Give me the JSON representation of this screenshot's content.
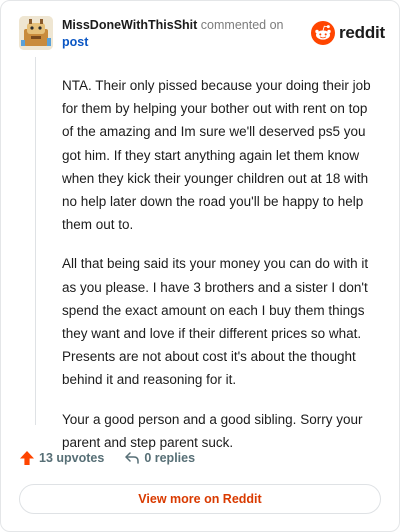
{
  "header": {
    "author": "MissDoneWithThisShit",
    "commented_on": "commented on",
    "post_link": "post",
    "brand": "reddit",
    "brand_color": "#ff4500"
  },
  "comment": {
    "paragraphs": [
      "NTA. Their only pissed because your doing their job for them by helping your bother out with rent on top of the amazing and Im sure we'll deserved ps5 you got him. If they start anything again let them know when they kick their younger children out at 18 with no help later down the road you'll be happy to help them out to.",
      "All that being said its your money you can do with it as you please. I have 3 brothers and a sister I don't spend the exact amount on each I buy them things they want and love if their different prices so what. Presents are not about cost it's about the thought behind it and reasoning for it.",
      "Your a good person and a good sibling. Sorry your parent and step parent suck."
    ]
  },
  "actions": {
    "upvotes": "13 upvotes",
    "replies": "0 replies",
    "upvote_icon": "upvote-arrow-icon",
    "reply_icon": "reply-arrow-icon"
  },
  "footer": {
    "view_more": "View more on Reddit",
    "accent_color": "#d93a00"
  }
}
